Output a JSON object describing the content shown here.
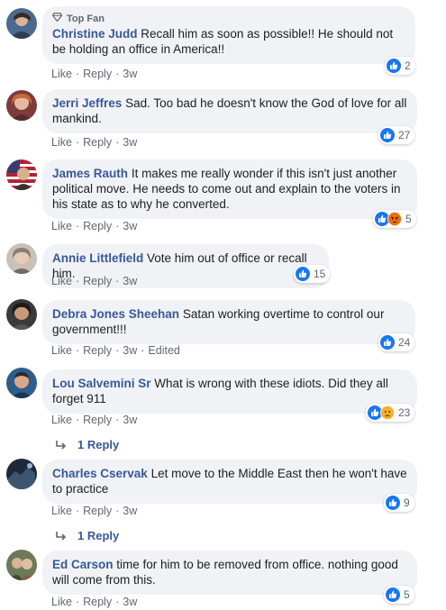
{
  "comments": [
    {
      "author": "Christine Judd",
      "text": "Recall him as soon as possible!! He should not be holding an office in America!!",
      "badge": "Top Fan",
      "actions": {
        "like": "Like",
        "reply": "Reply",
        "time": "3w"
      },
      "reaction_count": "2",
      "reactions": [
        "like"
      ]
    },
    {
      "author": "Jerri Jeffres",
      "text": "Sad. Too bad he doesn't know the God of love for all mankind.",
      "actions": {
        "like": "Like",
        "reply": "Reply",
        "time": "3w"
      },
      "reaction_count": "27",
      "reactions": [
        "like"
      ]
    },
    {
      "author": "James Rauth",
      "text": "It makes me really wonder if this isn't just another political move. He needs to come out and explain to the voters in his state as to why he converted.",
      "actions": {
        "like": "Like",
        "reply": "Reply",
        "time": "3w"
      },
      "reaction_count": "5",
      "reactions": [
        "like",
        "angry"
      ]
    },
    {
      "author": "Annie Littlefield",
      "text": "Vote him out of office or recall him.",
      "actions": {
        "like": "Like",
        "reply": "Reply",
        "time": "3w"
      },
      "reaction_count": "15",
      "reactions": [
        "like"
      ]
    },
    {
      "author": "Debra Jones Sheehan",
      "text": "Satan working overtime to control our government!!!",
      "actions": {
        "like": "Like",
        "reply": "Reply",
        "time": "3w",
        "edited": "Edited"
      },
      "reaction_count": "24",
      "reactions": [
        "like"
      ]
    },
    {
      "author": "Lou Salvemini Sr",
      "text": "What is wrong with these idiots. Did they all forget 911",
      "actions": {
        "like": "Like",
        "reply": "Reply",
        "time": "3w"
      },
      "reaction_count": "23",
      "reactions": [
        "like",
        "sad"
      ],
      "replies_label": "1 Reply"
    },
    {
      "author": "Charles Cservak",
      "text": "Let move to the Middle East then he won't have to practice",
      "actions": {
        "like": "Like",
        "reply": "Reply",
        "time": "3w"
      },
      "reaction_count": "9",
      "reactions": [
        "like"
      ],
      "replies_label": "1 Reply"
    },
    {
      "author": "Ed Carson",
      "text": "time for him to be removed from office. nothing good will come from this.",
      "actions": {
        "like": "Like",
        "reply": "Reply",
        "time": "3w"
      },
      "reaction_count": "5",
      "reactions": [
        "like"
      ]
    }
  ],
  "icons": {
    "badge": "diamond-icon",
    "like": "like-reaction-icon",
    "angry": "angry-reaction-icon",
    "sad": "sad-reaction-icon",
    "reply_arrow": "reply-arrow-icon"
  },
  "colors": {
    "author": "#385898",
    "bubble": "#f0f2f5",
    "meta": "#606770",
    "like_blue": "#1877f2",
    "angry": "#e9710f",
    "sad": "#f7b125"
  }
}
